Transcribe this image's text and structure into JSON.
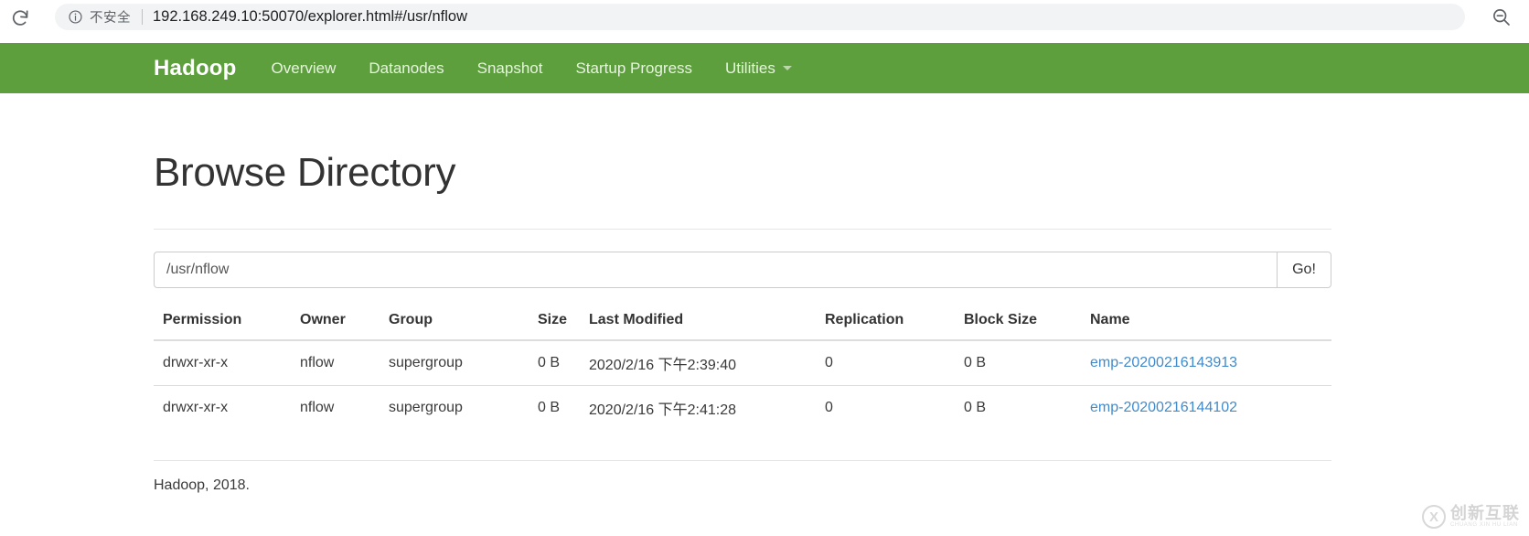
{
  "browser": {
    "reload_icon": "reload-icon",
    "info_icon": "info-circle-icon",
    "security_label": "不安全",
    "url": "192.168.249.10:50070/explorer.html#/usr/nflow",
    "zoom_out_icon": "zoom-out-magnifier-icon"
  },
  "navbar": {
    "brand": "Hadoop",
    "brand_color": "#ffffff",
    "background_color": "#5d9e3d",
    "items": [
      {
        "label": "Overview",
        "has_caret": false
      },
      {
        "label": "Datanodes",
        "has_caret": false
      },
      {
        "label": "Snapshot",
        "has_caret": false
      },
      {
        "label": "Startup Progress",
        "has_caret": false
      },
      {
        "label": "Utilities",
        "has_caret": true
      }
    ]
  },
  "page": {
    "title": "Browse Directory"
  },
  "path_form": {
    "value": "/usr/nflow",
    "placeholder": "",
    "go_label": "Go!"
  },
  "table": {
    "columns": [
      "Permission",
      "Owner",
      "Group",
      "Size",
      "Last Modified",
      "Replication",
      "Block Size",
      "Name"
    ],
    "rows": [
      {
        "permission": "drwxr-xr-x",
        "owner": "nflow",
        "group": "supergroup",
        "size": "0 B",
        "last_modified": "2020/2/16 下午2:39:40",
        "replication": "0",
        "block_size": "0 B",
        "name": "emp-20200216143913",
        "name_color": "#428bca"
      },
      {
        "permission": "drwxr-xr-x",
        "owner": "nflow",
        "group": "supergroup",
        "size": "0 B",
        "last_modified": "2020/2/16 下午2:41:28",
        "replication": "0",
        "block_size": "0 B",
        "name": "emp-20200216144102",
        "name_color": "#428bca"
      }
    ]
  },
  "footer": {
    "text": "Hadoop, 2018."
  },
  "watermark": {
    "mark": "X",
    "cn_text": "创新互联",
    "en_text": "CHUANG XIN HU LIAN"
  }
}
